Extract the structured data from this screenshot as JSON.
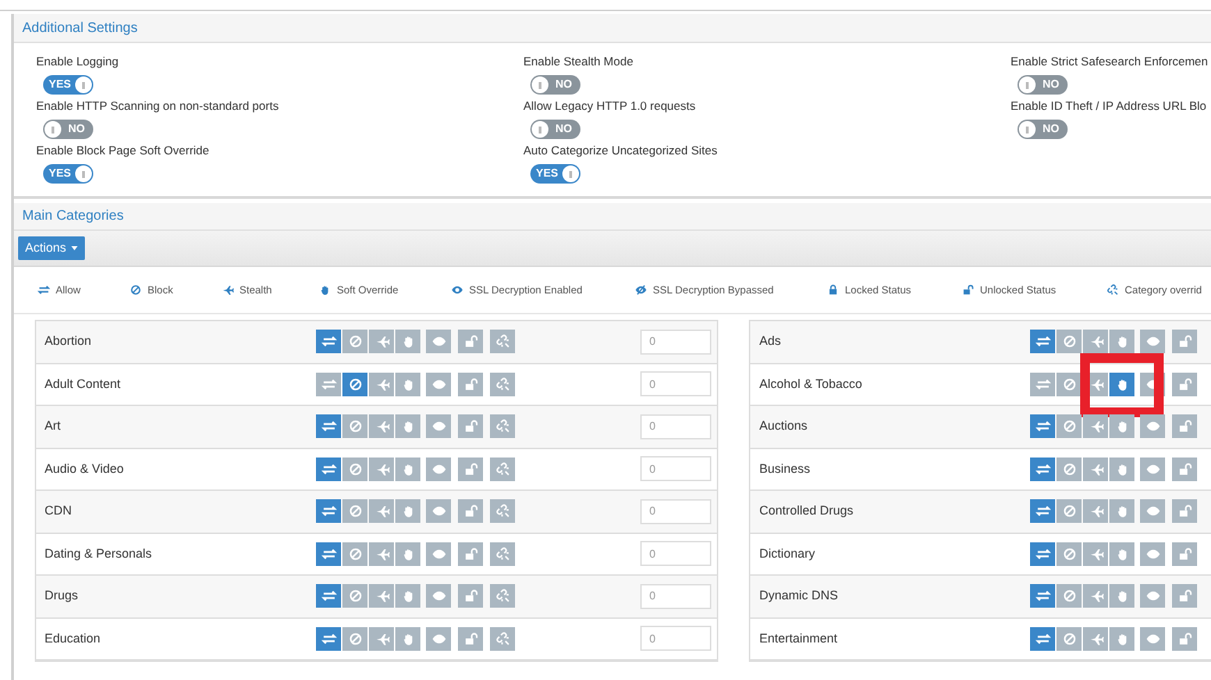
{
  "additional_settings": {
    "title": "Additional Settings",
    "settings": [
      {
        "label": "Enable Logging",
        "on": true,
        "text": "YES"
      },
      {
        "label": "Enable Stealth Mode",
        "on": false,
        "text": "NO"
      },
      {
        "label": "Enable Strict Safesearch Enforcemen",
        "on": false,
        "text": "NO"
      },
      {
        "label": "Enable HTTP Scanning on non-standard ports",
        "on": false,
        "text": "NO"
      },
      {
        "label": "Allow Legacy HTTP 1.0 requests",
        "on": false,
        "text": "NO"
      },
      {
        "label": "Enable ID Theft / IP Address URL Blo",
        "on": false,
        "text": "NO"
      },
      {
        "label": "Enable Block Page Soft Override",
        "on": true,
        "text": "YES"
      },
      {
        "label": "Auto Categorize Uncategorized Sites",
        "on": true,
        "text": "YES"
      }
    ]
  },
  "main_categories": {
    "title": "Main Categories",
    "actions_button": "Actions",
    "legend": [
      {
        "kind": "allow",
        "label": "Allow"
      },
      {
        "kind": "block",
        "label": "Block"
      },
      {
        "kind": "stealth",
        "label": "Stealth"
      },
      {
        "kind": "soft_override",
        "label": "Soft Override"
      },
      {
        "kind": "ssl_enabled",
        "label": "SSL Decryption Enabled"
      },
      {
        "kind": "ssl_bypassed",
        "label": "SSL Decryption Bypassed"
      },
      {
        "kind": "locked",
        "label": "Locked Status"
      },
      {
        "kind": "unlocked",
        "label": "Unlocked Status"
      },
      {
        "kind": "override",
        "label": "Category overrid"
      }
    ],
    "left_rows": [
      {
        "name": "Abortion",
        "allow": true,
        "block": false,
        "stealth": false,
        "soft_override": false,
        "value": "0"
      },
      {
        "name": "Adult Content",
        "allow": false,
        "block": true,
        "stealth": false,
        "soft_override": false,
        "value": "0"
      },
      {
        "name": "Art",
        "allow": true,
        "block": false,
        "stealth": false,
        "soft_override": false,
        "value": "0"
      },
      {
        "name": "Audio & Video",
        "allow": true,
        "block": false,
        "stealth": false,
        "soft_override": false,
        "value": "0"
      },
      {
        "name": "CDN",
        "allow": true,
        "block": false,
        "stealth": false,
        "soft_override": false,
        "value": "0"
      },
      {
        "name": "Dating & Personals",
        "allow": true,
        "block": false,
        "stealth": false,
        "soft_override": false,
        "value": "0"
      },
      {
        "name": "Drugs",
        "allow": true,
        "block": false,
        "stealth": false,
        "soft_override": false,
        "value": "0"
      },
      {
        "name": "Education",
        "allow": true,
        "block": false,
        "stealth": false,
        "soft_override": false,
        "value": "0"
      }
    ],
    "right_rows": [
      {
        "name": "Ads",
        "allow": true,
        "block": false,
        "stealth": false,
        "soft_override": false,
        "highlighted": false
      },
      {
        "name": "Alcohol & Tobacco",
        "allow": false,
        "block": false,
        "stealth": false,
        "soft_override": true,
        "highlighted": true
      },
      {
        "name": "Auctions",
        "allow": true,
        "block": false,
        "stealth": false,
        "soft_override": false,
        "highlighted": false
      },
      {
        "name": "Business",
        "allow": true,
        "block": false,
        "stealth": false,
        "soft_override": false,
        "highlighted": false
      },
      {
        "name": "Controlled Drugs",
        "allow": true,
        "block": false,
        "stealth": false,
        "soft_override": false,
        "highlighted": false
      },
      {
        "name": "Dictionary",
        "allow": true,
        "block": false,
        "stealth": false,
        "soft_override": false,
        "highlighted": false
      },
      {
        "name": "Dynamic DNS",
        "allow": true,
        "block": false,
        "stealth": false,
        "soft_override": false,
        "highlighted": false
      },
      {
        "name": "Entertainment",
        "allow": true,
        "block": false,
        "stealth": false,
        "soft_override": false,
        "highlighted": false
      }
    ]
  }
}
